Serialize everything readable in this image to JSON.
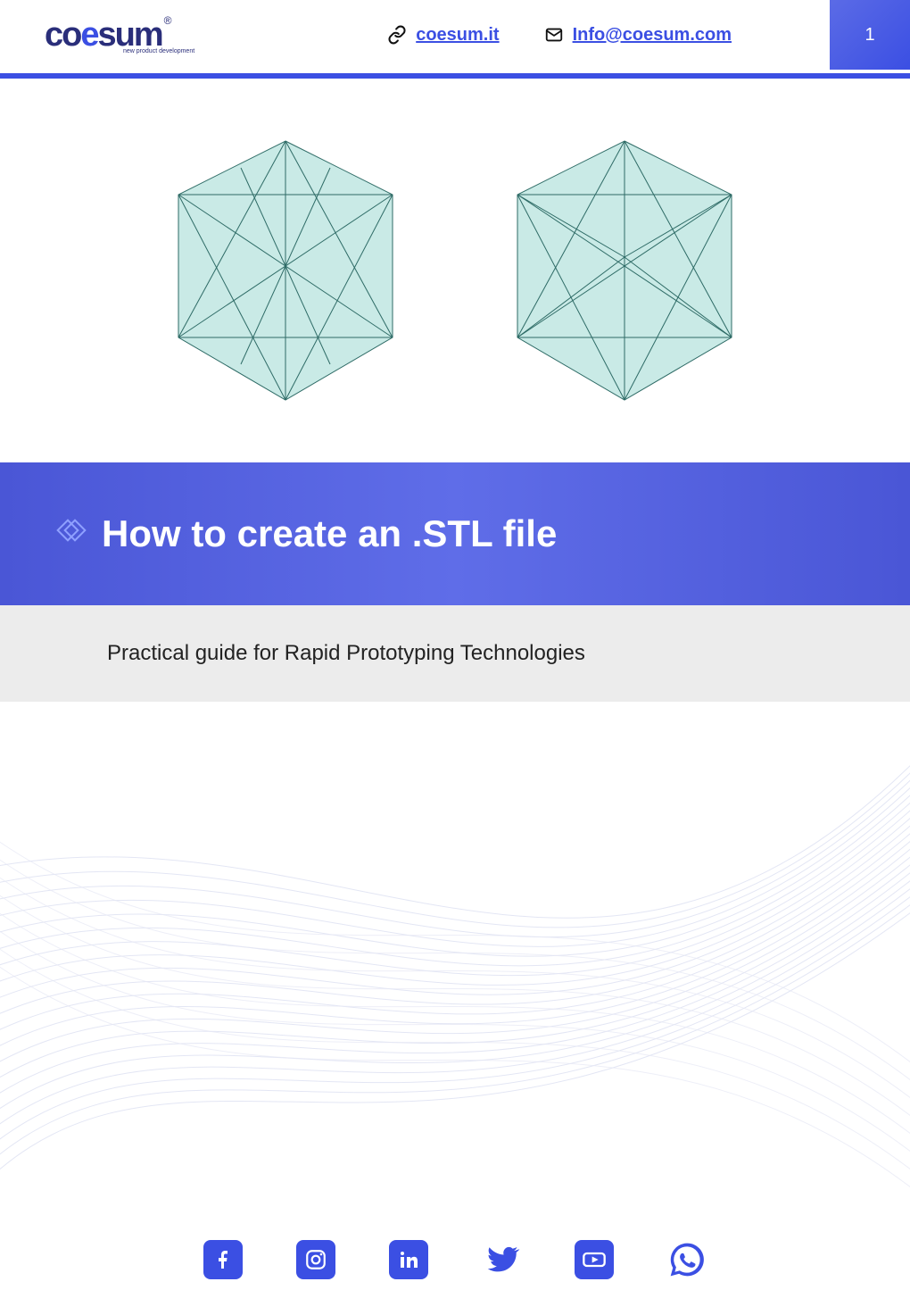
{
  "brand": {
    "name_part1": "co",
    "name_swirl": "e",
    "name_part2": "sum",
    "registered": "®",
    "tagline": "new product development"
  },
  "header": {
    "website_label": "coesum.it",
    "email_label": "Info@coesum.com",
    "page_number": "1"
  },
  "title": "How to create an .STL file",
  "subtitle": "Practical guide for Rapid Prototyping Technologies",
  "social": {
    "facebook": "facebook",
    "instagram": "instagram",
    "linkedin": "linkedin",
    "twitter": "twitter",
    "youtube": "youtube",
    "whatsapp": "whatsapp"
  },
  "colors": {
    "accent": "#3b4fe3",
    "dark": "#2a2e7a",
    "cube_fill": "#b7e3de",
    "cube_edge": "#2e6b66"
  }
}
